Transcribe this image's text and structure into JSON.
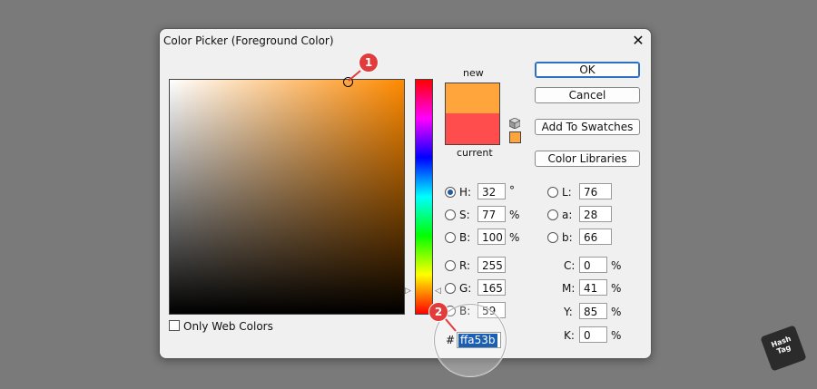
{
  "dialog": {
    "title": "Color Picker (Foreground Color)",
    "close_glyph": "✕"
  },
  "swatch": {
    "new_label": "new",
    "current_label": "current",
    "new_color": "#ffa53b",
    "current_color": "#ff4c4c"
  },
  "buttons": {
    "ok": "OK",
    "cancel": "Cancel",
    "add_swatches": "Add To Swatches",
    "libraries": "Color Libraries"
  },
  "hsb": {
    "h": {
      "label": "H:",
      "value": "32",
      "unit": "°",
      "selected": true
    },
    "s": {
      "label": "S:",
      "value": "77",
      "unit": "%"
    },
    "b": {
      "label": "B:",
      "value": "100",
      "unit": "%"
    }
  },
  "rgb": {
    "r": {
      "label": "R:",
      "value": "255"
    },
    "g": {
      "label": "G:",
      "value": "165"
    },
    "b": {
      "label": "B:",
      "value": "59"
    }
  },
  "lab": {
    "l": {
      "label": "L:",
      "value": "76"
    },
    "a": {
      "label": "a:",
      "value": "28"
    },
    "b": {
      "label": "b:",
      "value": "66"
    }
  },
  "cmyk": {
    "c": {
      "label": "C:",
      "value": "0",
      "unit": "%"
    },
    "m": {
      "label": "M:",
      "value": "41",
      "unit": "%"
    },
    "y": {
      "label": "Y:",
      "value": "85",
      "unit": "%"
    },
    "k": {
      "label": "K:",
      "value": "0",
      "unit": "%"
    }
  },
  "hex": {
    "label": "#",
    "value": "ffa53b"
  },
  "web_colors": {
    "label": "Only Web Colors",
    "checked": false
  },
  "annotations": {
    "badge1": "1",
    "badge2": "2"
  },
  "brand": {
    "line1": "Hash",
    "line2": "Tag"
  },
  "colors": {
    "accent": "#1f5ba8",
    "badge": "#e23b3b",
    "selection": "#1a5fb4"
  }
}
